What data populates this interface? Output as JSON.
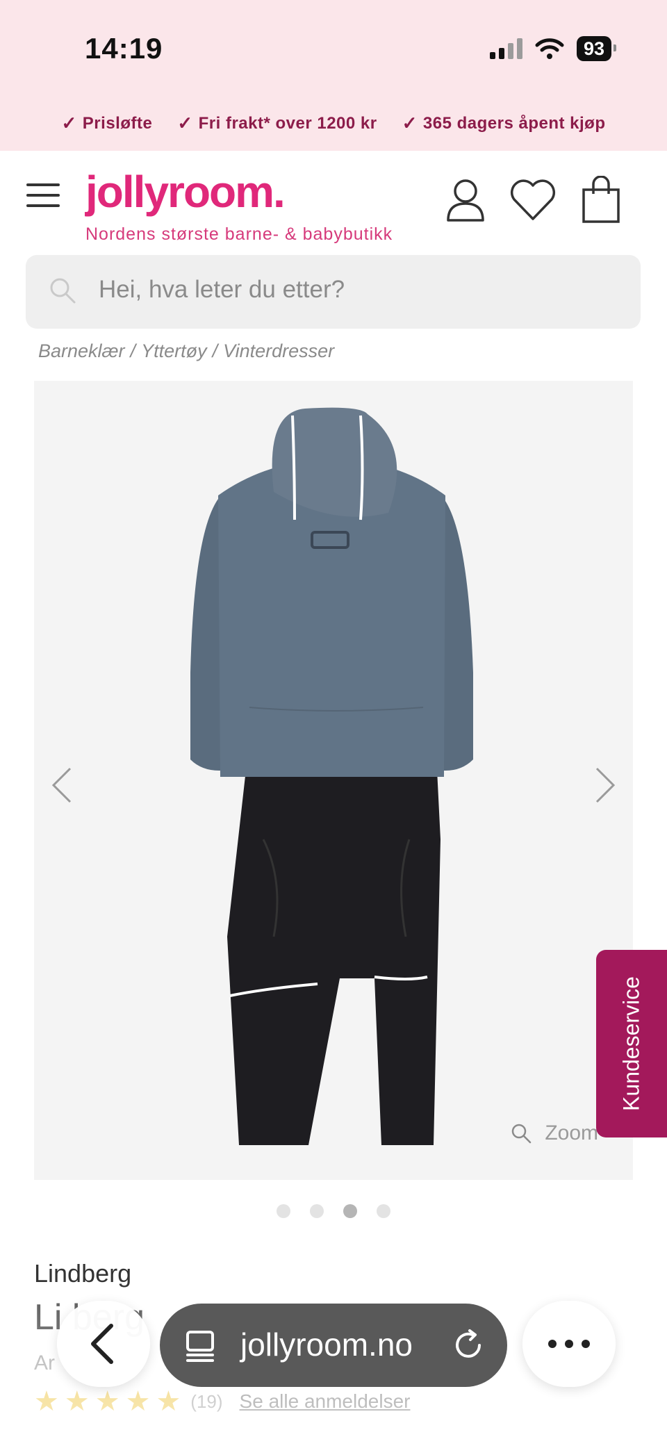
{
  "status": {
    "time": "14:19",
    "battery": "93"
  },
  "usps": [
    "Prisløfte",
    "Fri frakt* over 1200 kr",
    "365 dagers åpent kjøp"
  ],
  "header": {
    "logo": "jollyroom.",
    "tagline": "Nordens største barne- & babybutikk"
  },
  "search": {
    "placeholder": "Hei, hva leter du etter?"
  },
  "breadcrumb": [
    "Barneklær",
    "Yttertøy",
    "Vinterdresser"
  ],
  "gallery": {
    "zoom_label": "Zoom",
    "image_count": 4,
    "active_index": 3
  },
  "kundeservice": "Kundeservice",
  "product": {
    "brand": "Lindberg",
    "title_visible": "Li  berg",
    "article_visible": "Ar",
    "rating": 5,
    "review_count": "(19)",
    "reviews_link": "Se alle anmeldelser"
  },
  "browser": {
    "url": "jollyroom.no"
  },
  "colors": {
    "brand_pink": "#e0287a",
    "usp_text": "#8c1c4a",
    "kundeservice_bg": "#a3195b"
  }
}
